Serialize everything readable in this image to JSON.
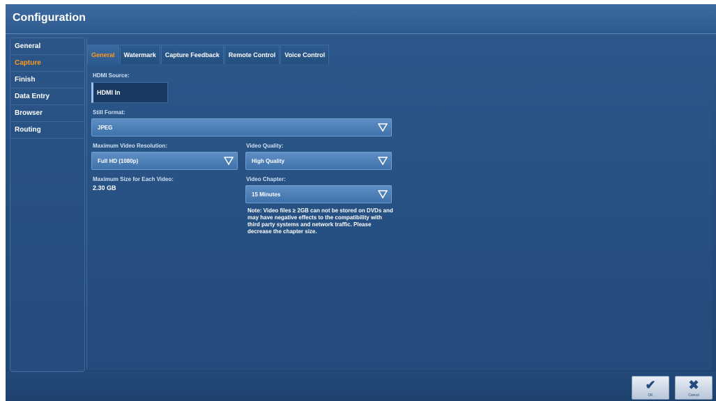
{
  "window": {
    "title": "Configuration"
  },
  "sidebar": {
    "items": [
      {
        "label": "General"
      },
      {
        "label": "Capture",
        "active": true
      },
      {
        "label": "Finish"
      },
      {
        "label": "Data Entry"
      },
      {
        "label": "Browser"
      },
      {
        "label": "Routing"
      }
    ]
  },
  "tabs": [
    {
      "label": "General",
      "active": true
    },
    {
      "label": "Watermark"
    },
    {
      "label": "Capture Feedback"
    },
    {
      "label": "Remote Control"
    },
    {
      "label": "Voice Control"
    }
  ],
  "form": {
    "hdmi_source_label": "HDMI Source:",
    "hdmi_source_value": "HDMI In",
    "still_format_label": "Still Format:",
    "still_format_value": "JPEG",
    "max_res_label": "Maximum Video Resolution:",
    "max_res_value": "Full HD (1080p)",
    "video_quality_label": "Video Quality:",
    "video_quality_value": "High Quality",
    "max_size_label": "Maximum Size for Each Video:",
    "max_size_value": "2.30 GB",
    "video_chapter_label": "Video Chapter:",
    "video_chapter_value": "15 Minutes",
    "note": "Note: Video files ≥ 2GB can not be stored on DVDs and may have negative effects to the compatibility with third party systems and network traffic. Please decrease the chapter size."
  },
  "buttons": {
    "ok_label": "OK",
    "cancel_label": "Cancel"
  },
  "colors": {
    "accent": "#ff9a1e",
    "background": "#264f80"
  }
}
